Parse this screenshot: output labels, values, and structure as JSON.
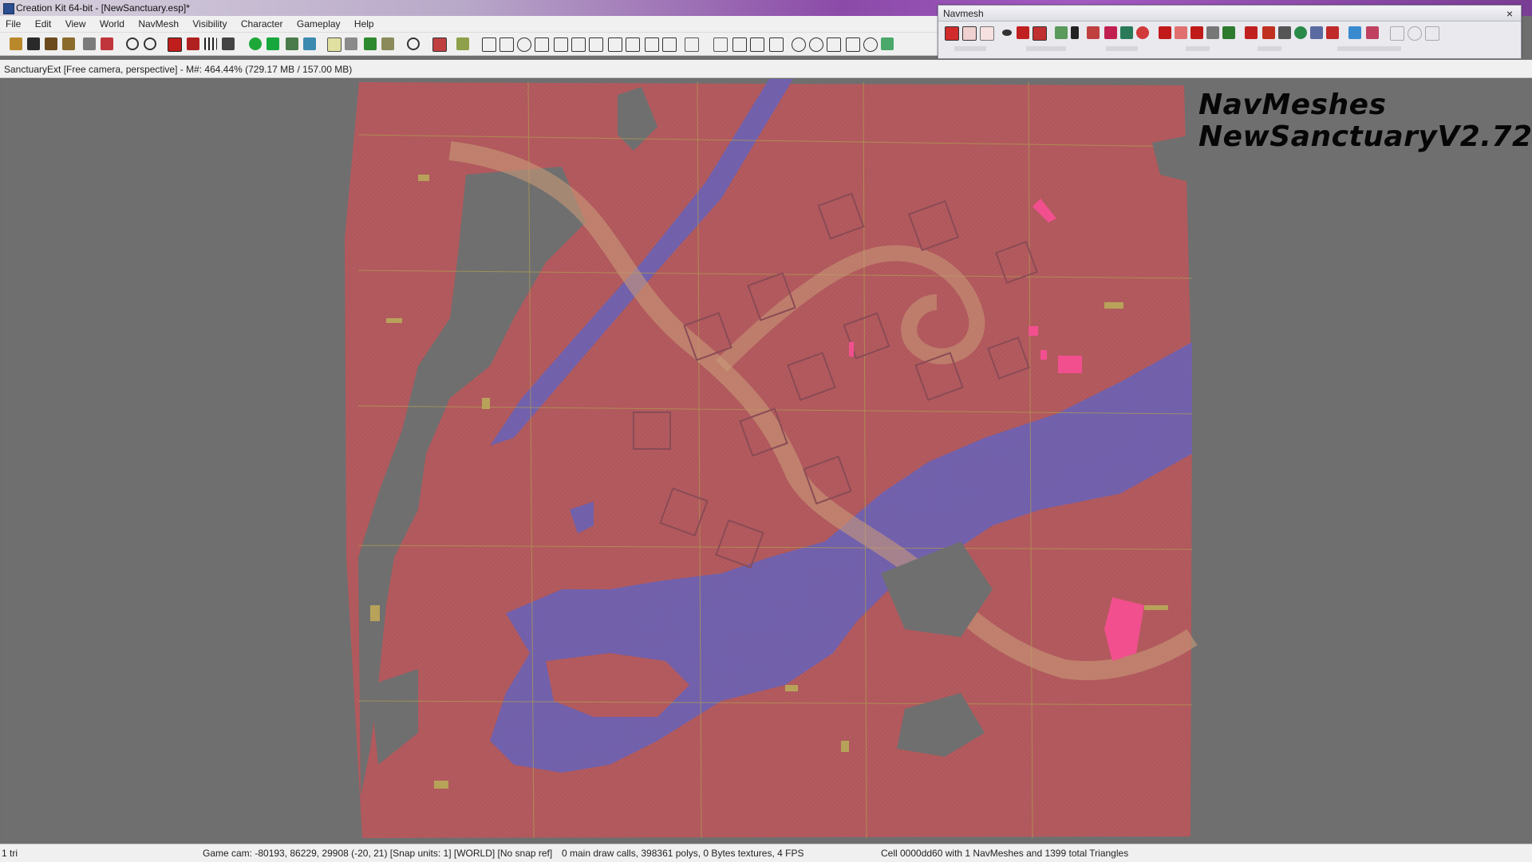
{
  "window": {
    "title": "Creation Kit 64-bit - [NewSanctuary.esp]*"
  },
  "menu": [
    "File",
    "Edit",
    "View",
    "World",
    "NavMesh",
    "Visibility",
    "Character",
    "Gameplay",
    "Help"
  ],
  "navmesh_window": {
    "title": "Navmesh",
    "close_label": "×"
  },
  "viewport": {
    "header": "SanctuaryExt [Free camera, perspective] - M#: 464.44% (729.17 MB / 157.00 MB)",
    "overlay_line1": "NavMeshes",
    "overlay_line2": "NewSanctuaryV2.72"
  },
  "status": {
    "selection": "1 tri",
    "camera": "Game cam: -80193, 86229, 29908 (-20, 21) [Snap units: 1] [WORLD] [No snap ref]",
    "render": "0 main draw calls, 398361 polys, 0 Bytes textures, 4 FPS",
    "cell": "Cell 0000dd60 with 1 NavMeshes and 1399 total Triangles"
  },
  "colors": {
    "navmesh_red": "#b35a5e",
    "water_blue": "#6f62ae",
    "highlight_pink": "#f24f8f",
    "cover_yellow": "#b8a25a",
    "road_tan": "#c89a78",
    "background_gray": "#6f6f6f"
  },
  "icons": {
    "toolbar": [
      "open-icon",
      "save-icon",
      "save-all-icon",
      "load-icon",
      "data-icon",
      "object-icon",
      "undo-icon",
      "redo-icon",
      "render-icon",
      "lighting-icon",
      "grid-icon",
      "snap-icon",
      "sphere-icon",
      "terrain-icon",
      "landscape-icon",
      "cell-icon",
      "marker-icon",
      "light-icon",
      "tree-icon",
      "sound-icon",
      "portal-icon",
      "room-icon",
      "bound-icon"
    ],
    "navmesh": [
      "select-triangle-icon",
      "select-edge-icon",
      "select-vertex-icon",
      "eye-icon",
      "cover-icon",
      "camera-icon",
      "finalize-icon",
      "b-icon",
      "triangle-icon",
      "check-icon",
      "water-icon",
      "sphere-icon",
      "flag-icon",
      "tag-icon",
      "preferred-icon",
      "tree-icon",
      "door-icon",
      "ledge-icon",
      "rotate-icon",
      "refresh-icon",
      "merge-icon",
      "split-icon",
      "cover-edit-icon",
      "filter-icon",
      "copy-icon",
      "circle-icon",
      "panel-icon"
    ]
  }
}
